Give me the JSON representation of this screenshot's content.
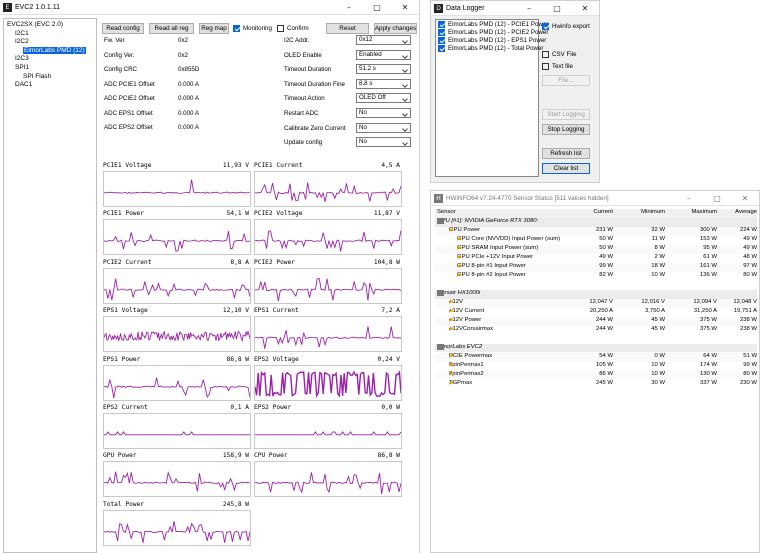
{
  "evc": {
    "title": "EVC2 1.0.1.11",
    "tree": [
      "EVC2SX (EVC 2.0)",
      "I2C1",
      "I2C2",
      "ElmorLabs PMD (12)",
      "I2C3",
      "SPI1",
      "SPI Flash",
      "DAC1"
    ],
    "buttons": {
      "read_config": "Read config",
      "read_all_reg": "Read all reg",
      "reg_map": "Reg map",
      "reset": "Reset",
      "apply": "Apply changes"
    },
    "monitoring": "Monitoring",
    "confirm": "Confirm",
    "info": [
      {
        "label": "Fw. Ver",
        "value": "0x2"
      },
      {
        "label": "Config Ver.",
        "value": "0x2"
      },
      {
        "label": "Config CRC",
        "value": "0x855D"
      },
      {
        "label": "ADC PCIE1 Offset",
        "value": "0.000 A"
      },
      {
        "label": "ADC PCIE2 Offset",
        "value": "0.000 A"
      },
      {
        "label": "ADC EPS1 Offset",
        "value": "0.000 A"
      },
      {
        "label": "ADC EPS2 Offset",
        "value": "0.000 A"
      }
    ],
    "settings": [
      {
        "label": "I2C Addr.",
        "value": "0x12"
      },
      {
        "label": "OLED Enable",
        "value": "Enabled"
      },
      {
        "label": "Timeout Duration",
        "value": "51.2 s"
      },
      {
        "label": "Timeout Duration Fine",
        "value": "8.8 s"
      },
      {
        "label": "Timeout Action",
        "value": "OLED Off"
      },
      {
        "label": "Restart ADC",
        "value": "No"
      },
      {
        "label": "Calibrate Zero Current",
        "value": "No"
      },
      {
        "label": "Update config",
        "value": "No"
      }
    ],
    "plots": [
      {
        "name": "PCIE1 Voltage",
        "value": "11,93 V",
        "style": "spike"
      },
      {
        "name": "PCIE1 Current",
        "value": "4,5 A",
        "style": "noisy"
      },
      {
        "name": "PCIE1 Power",
        "value": "54,1 W",
        "style": "noisy"
      },
      {
        "name": "PCIE2 Voltage",
        "value": "11,87 V",
        "style": "noisy"
      },
      {
        "name": "PCIE2 Current",
        "value": "8,8 A",
        "style": "noisy"
      },
      {
        "name": "PCIE2 Power",
        "value": "104,8 W",
        "style": "noisy"
      },
      {
        "name": "EPS1 Voltage",
        "value": "12,10 V",
        "style": "dense"
      },
      {
        "name": "EPS1 Current",
        "value": "7,2 A",
        "style": "noisy"
      },
      {
        "name": "EPS1 Power",
        "value": "86,8 W",
        "style": "noisy"
      },
      {
        "name": "EPS2 Voltage",
        "value": "0,24 V",
        "style": "heavy"
      },
      {
        "name": "EPS2 Current",
        "value": "0,1 A",
        "style": "flat"
      },
      {
        "name": "EPS2 Power",
        "value": "0,0 W",
        "style": "flat"
      },
      {
        "name": "GPU Power",
        "value": "158,9 W",
        "style": "noisy"
      },
      {
        "name": "CPU Power",
        "value": "86,8 W",
        "style": "noisy"
      },
      {
        "name": "Total Power",
        "value": "245,8 W",
        "style": "noisy"
      }
    ]
  },
  "logger": {
    "title": "Data Logger",
    "items": [
      "ElmorLabs PMD (12) - PCIE1 Power",
      "ElmorLabs PMD (12) - PCIE2 Power",
      "ElmorLabs PMD (12) - EPS1 Power",
      "ElmorLabs PMD (12) - Total Power"
    ],
    "hwinfo_export": "Hwinfo export",
    "csv_file": "CSV File",
    "text_file": "Text file",
    "file_button": "File...",
    "start_logging": "Start Logging",
    "stop_logging": "Stop Logging",
    "refresh_list": "Refresh list",
    "clear_list": "Clear list"
  },
  "hwinfo": {
    "title": "HWiNFO64 v7.24-4770 Sensor Status [511 values hidden]",
    "columns": [
      "Sensor",
      "Current",
      "Minimum",
      "Maximum",
      "Average"
    ],
    "groups": [
      {
        "name": "GPU [#1]: NVIDIA GeForce RTX 3080:",
        "rows": [
          {
            "label": "GPU Power",
            "indent": 0,
            "current": "231 W",
            "min": "32 W",
            "max": "300 W",
            "avg": "224 W"
          },
          {
            "label": "GPU Core (NVVDD) Input Power (sum)",
            "indent": 1,
            "current": "50 W",
            "min": "11 W",
            "max": "153 W",
            "avg": "49 W"
          },
          {
            "label": "GPU SRAM Input Power (sum)",
            "indent": 1,
            "current": "50 W",
            "min": "8 W",
            "max": "95 W",
            "avg": "49 W"
          },
          {
            "label": "GPU PCIe +12V Input Power",
            "indent": 1,
            "current": "49 W",
            "min": "2 W",
            "max": "61 W",
            "avg": "48 W"
          },
          {
            "label": "GPU 8-pin #1 Input Power",
            "indent": 1,
            "current": "99 W",
            "min": "18 W",
            "max": "161 W",
            "avg": "97 W"
          },
          {
            "label": "GPU 8-pin #2 Input Power",
            "indent": 1,
            "current": "82 W",
            "min": "10 W",
            "max": "136 W",
            "avg": "80 W"
          }
        ]
      },
      {
        "name": "Corsair HX1000i",
        "rows": [
          {
            "label": "+12V",
            "indent": 0,
            "current": "12,047 V",
            "min": "12,016 V",
            "max": "12,094 V",
            "avg": "12,048 V"
          },
          {
            "label": "+12V Current",
            "indent": 0,
            "current": "20,250 A",
            "min": "3,750 A",
            "max": "31,250 A",
            "avg": "19,751 A"
          },
          {
            "label": "+12V Power",
            "indent": 0,
            "current": "244 W",
            "min": "45 W",
            "max": "375 W",
            "avg": "238 W"
          },
          {
            "label": "+12VCorsairmax",
            "indent": 0,
            "current": "244 W",
            "min": "45 W",
            "max": "375 W",
            "avg": "238 W"
          }
        ]
      },
      {
        "name": "ElmorLabs EVC2",
        "rows": [
          {
            "label": "PCIE Powermax",
            "indent": 0,
            "current": "54 W",
            "min": "0 W",
            "max": "64 W",
            "avg": "51 W"
          },
          {
            "label": "8pinPermax1",
            "indent": 0,
            "current": "105 W",
            "min": "10 W",
            "max": "174 W",
            "avg": "99 W"
          },
          {
            "label": "8pinPermax2",
            "indent": 0,
            "current": "86 W",
            "min": "10 W",
            "max": "130 W",
            "avg": "80 W"
          },
          {
            "label": "TGPmax",
            "indent": 0,
            "current": "245 W",
            "min": "30 W",
            "max": "337 W",
            "avg": "230 W"
          }
        ]
      }
    ]
  },
  "colors": {
    "plot_line": "#9b1fa8",
    "accent": "#0a66d6"
  }
}
